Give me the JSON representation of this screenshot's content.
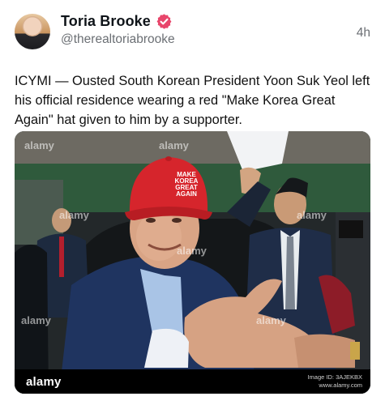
{
  "post": {
    "author_name": "Toria Brooke",
    "author_handle": "@therealtoriabrooke",
    "timestamp": "4h",
    "verified_icon": "verified-badge-icon",
    "text": "ICYMI — Ousted South Korean President Yoon Suk Yeol left his official residence wearing a red \"Make Korea Great Again\" hat given to him by a supporter."
  },
  "media": {
    "hat_text": [
      "MAKE",
      "KOREA",
      "GREAT",
      "AGAIN"
    ],
    "watermark": "alamy",
    "footer_logo": "alamy",
    "footer_image_id": "Image ID: 3AJEKBX",
    "footer_site": "www.alamy.com"
  },
  "colors": {
    "verified": "#e8466b",
    "hat": "#d6252c",
    "handle_gray": "#6b6f74"
  }
}
